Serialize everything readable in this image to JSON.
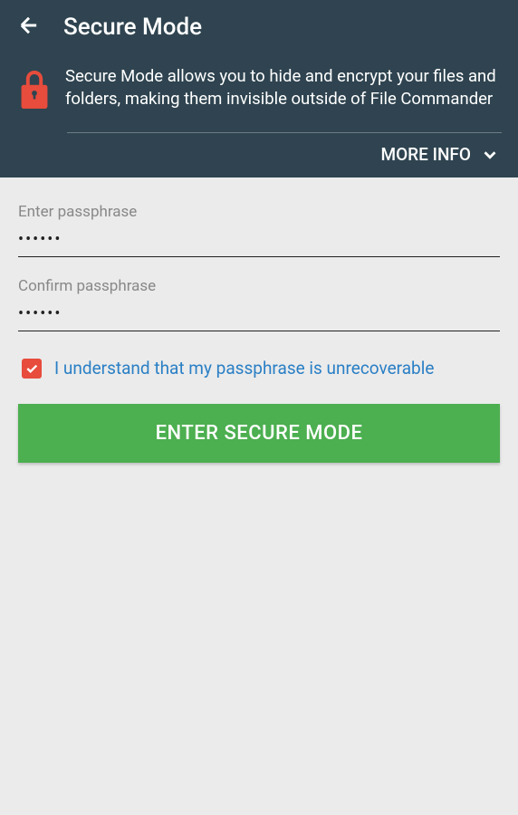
{
  "header": {
    "title": "Secure Mode",
    "description": "Secure Mode allows you to hide and encrypt your files and folders, making them invisible outside of File Commander",
    "more_info_label": "MORE INFO"
  },
  "form": {
    "passphrase_label": "Enter passphrase",
    "passphrase_value": "••••••",
    "confirm_label": "Confirm passphrase",
    "confirm_value": "••••••",
    "checkbox_label": "I understand that my passphrase is unrecoverable",
    "submit_label": "ENTER SECURE MODE"
  },
  "colors": {
    "header_bg": "#2f4450",
    "accent_red": "#e74c3c",
    "link_blue": "#2a7fc5",
    "button_green": "#4caf50"
  }
}
